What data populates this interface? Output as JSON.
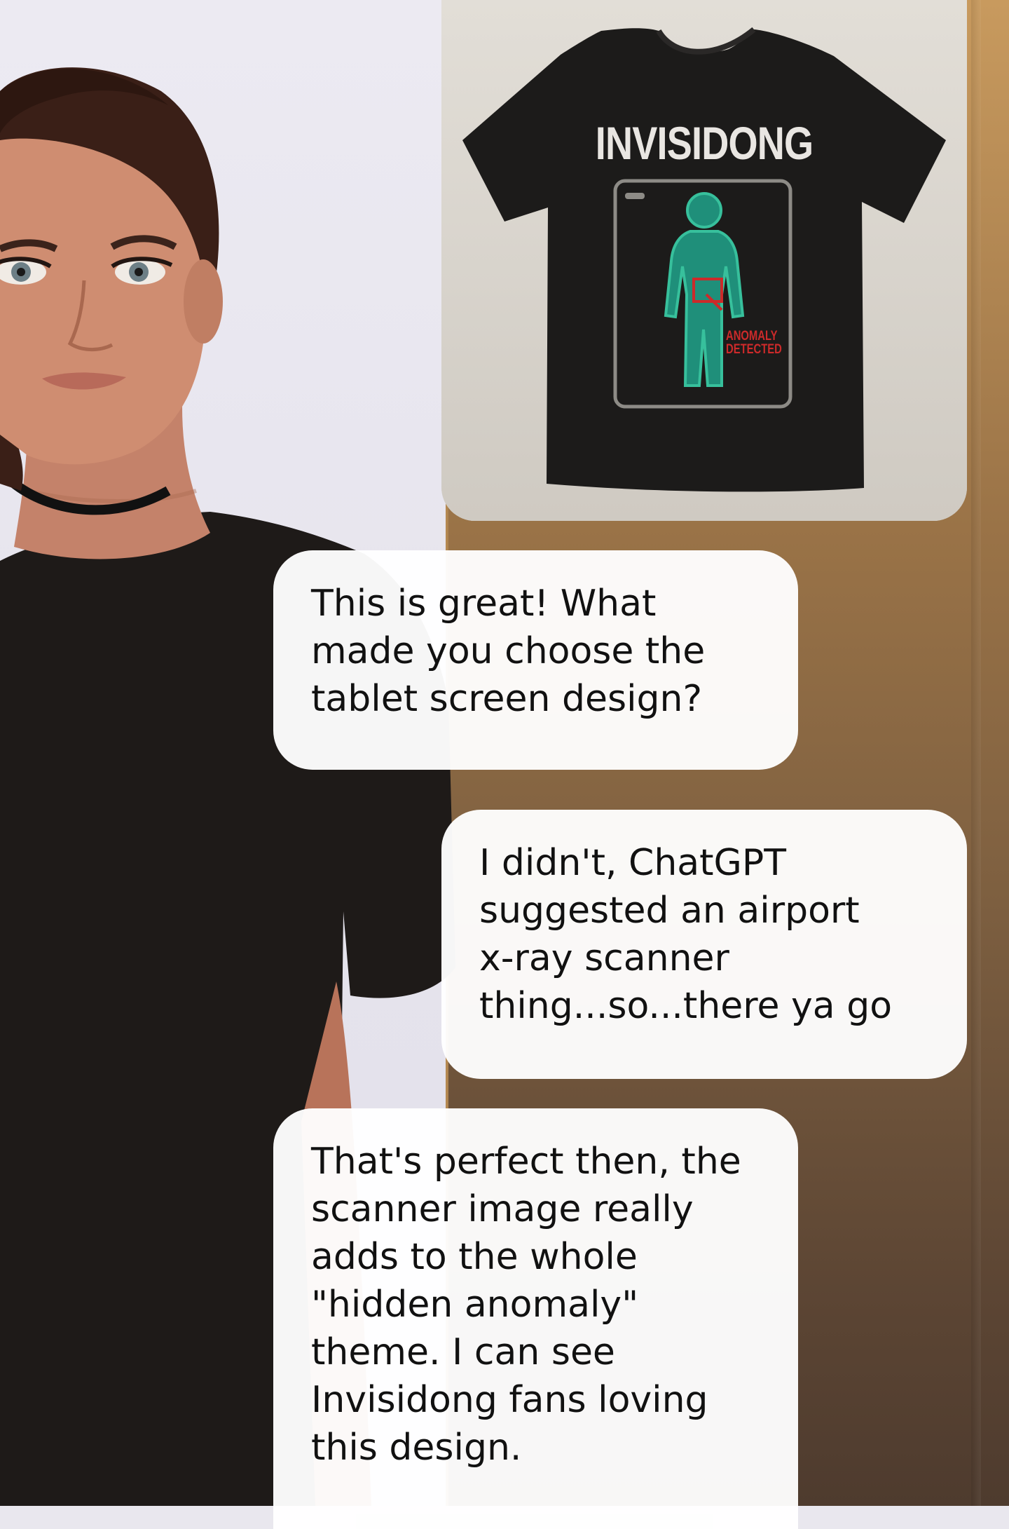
{
  "product": {
    "shirt_title": "INVISIDONG",
    "anomaly_line1": "ANOMALY",
    "anomaly_line2": "DETECTED"
  },
  "messages": [
    {
      "sender": "assistant",
      "lines": [
        "This is great! What",
        "made you choose the",
        "tablet screen design?"
      ]
    },
    {
      "sender": "user",
      "lines": [
        "I didn't, ChatGPT",
        "suggested an airport",
        "x-ray scanner",
        "thing...so...there ya go"
      ]
    },
    {
      "sender": "assistant",
      "lines": [
        "That's perfect then, the",
        "scanner image really",
        "adds to the whole",
        "\"hidden anomaly\"",
        "theme. I can see",
        "Invisidong fans loving",
        "this design."
      ]
    }
  ],
  "colors": {
    "bubble_bg": "#ffffff",
    "shirt": "#1c1b1a",
    "scanner_figure": "#1f8f7a",
    "anomaly_red": "#cc2a2a"
  }
}
